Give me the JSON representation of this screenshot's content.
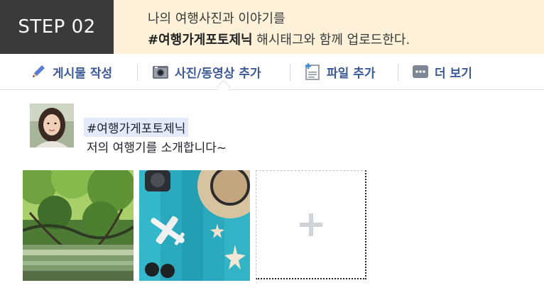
{
  "step": {
    "badge": "STEP 02",
    "line1": "나의 여행사진과 이야기를",
    "hashtag": "#여행가게포토제닉",
    "line2_rest": " 해시태그와 함께 업로드한다."
  },
  "toolbar": {
    "items": [
      {
        "label": "게시물 작성",
        "icon": "pencil-icon"
      },
      {
        "label": "사진/동영상 추가",
        "icon": "camera-icon"
      },
      {
        "label": "파일 추가",
        "icon": "file-add-icon"
      },
      {
        "label": "더 보기",
        "icon": "more-icon"
      }
    ]
  },
  "post": {
    "hashtag": "#여행가게포토제닉",
    "text": "저의 여행기를 소개합니다~"
  },
  "attachments": {
    "photos": [
      "forest-river-photo",
      "travel-flatlay-photo"
    ],
    "add_icon": "plus-icon"
  },
  "colors": {
    "banner_bg": "#fdf1d9",
    "badge_bg": "#3a3a3a",
    "link": "#3b5998",
    "tag_highlight": "#e3ebfa"
  }
}
